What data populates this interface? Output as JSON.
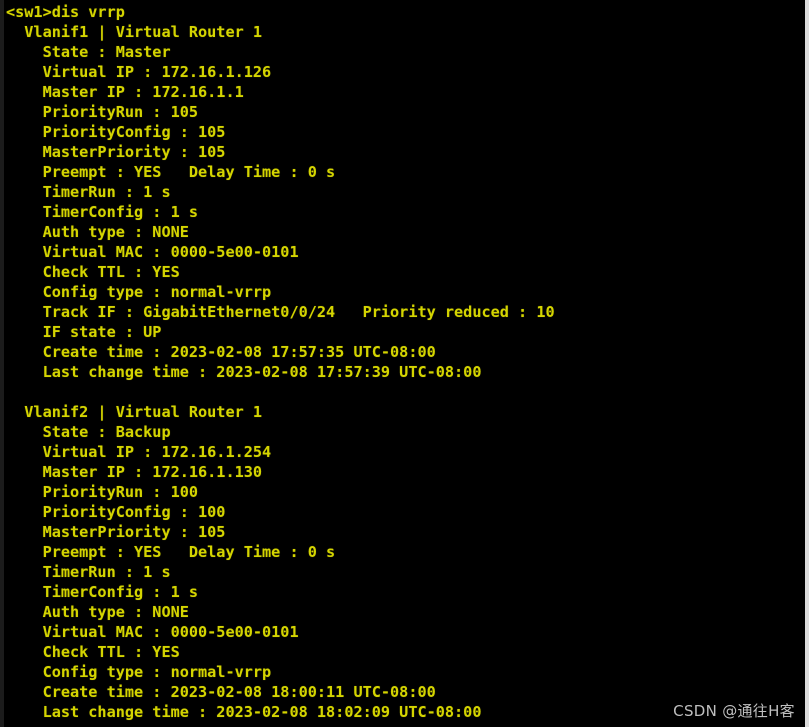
{
  "window": {
    "title": "VRRP Terminal Output",
    "background_color": "#000000",
    "text_color": "#d4d400",
    "left_edge_color": "#1c1c1c",
    "right_edge_color": "#dcdcdc"
  },
  "terminal": {
    "prompt": "<sw1>",
    "command": "dis vrrp",
    "prompt_line": "<sw1>dis vrrp",
    "lines": [
      "<sw1>dis vrrp",
      "  Vlanif1 | Virtual Router 1",
      "    State : Master",
      "    Virtual IP : 172.16.1.126",
      "    Master IP : 172.16.1.1",
      "    PriorityRun : 105",
      "    PriorityConfig : 105",
      "    MasterPriority : 105",
      "    Preempt : YES   Delay Time : 0 s",
      "    TimerRun : 1 s",
      "    TimerConfig : 1 s",
      "    Auth type : NONE",
      "    Virtual MAC : 0000-5e00-0101",
      "    Check TTL : YES",
      "    Config type : normal-vrrp",
      "    Track IF : GigabitEthernet0/0/24   Priority reduced : 10",
      "    IF state : UP",
      "    Create time : 2023-02-08 17:57:35 UTC-08:00",
      "    Last change time : 2023-02-08 17:57:39 UTC-08:00",
      "",
      "  Vlanif2 | Virtual Router 1",
      "    State : Backup",
      "    Virtual IP : 172.16.1.254",
      "    Master IP : 172.16.1.130",
      "    PriorityRun : 100",
      "    PriorityConfig : 100",
      "    MasterPriority : 105",
      "    Preempt : YES   Delay Time : 0 s",
      "    TimerRun : 1 s",
      "    TimerConfig : 1 s",
      "    Auth type : NONE",
      "    Virtual MAC : 0000-5e00-0101",
      "    Check TTL : YES",
      "    Config type : normal-vrrp",
      "    Create time : 2023-02-08 18:00:11 UTC-08:00",
      "    Last change time : 2023-02-08 18:02:09 UTC-08:00"
    ]
  },
  "vrrp_groups": [
    {
      "interface": "Vlanif1",
      "header": "Vlanif1 | Virtual Router 1",
      "virtual_router_id": "1",
      "state": "Master",
      "virtual_ip": "172.16.1.126",
      "master_ip": "172.16.1.1",
      "priority_run": "105",
      "priority_config": "105",
      "master_priority": "105",
      "preempt": "YES",
      "delay_time": "0 s",
      "timer_run": "1 s",
      "timer_config": "1 s",
      "auth_type": "NONE",
      "virtual_mac": "0000-5e00-0101",
      "check_ttl": "YES",
      "config_type": "normal-vrrp",
      "track_if": "GigabitEthernet0/0/24",
      "priority_reduced": "10",
      "if_state": "UP",
      "create_time": "2023-02-08 17:57:35 UTC-08:00",
      "last_change_time": "2023-02-08 17:57:39 UTC-08:00"
    },
    {
      "interface": "Vlanif2",
      "header": "Vlanif2 | Virtual Router 1",
      "virtual_router_id": "1",
      "state": "Backup",
      "virtual_ip": "172.16.1.254",
      "master_ip": "172.16.1.130",
      "priority_run": "100",
      "priority_config": "100",
      "master_priority": "105",
      "preempt": "YES",
      "delay_time": "0 s",
      "timer_run": "1 s",
      "timer_config": "1 s",
      "auth_type": "NONE",
      "virtual_mac": "0000-5e00-0101",
      "check_ttl": "YES",
      "config_type": "normal-vrrp",
      "create_time": "2023-02-08 18:00:11 UTC-08:00",
      "last_change_time": "2023-02-08 18:02:09 UTC-08:00"
    }
  ],
  "watermark": {
    "text": "CSDN @通往H客"
  }
}
